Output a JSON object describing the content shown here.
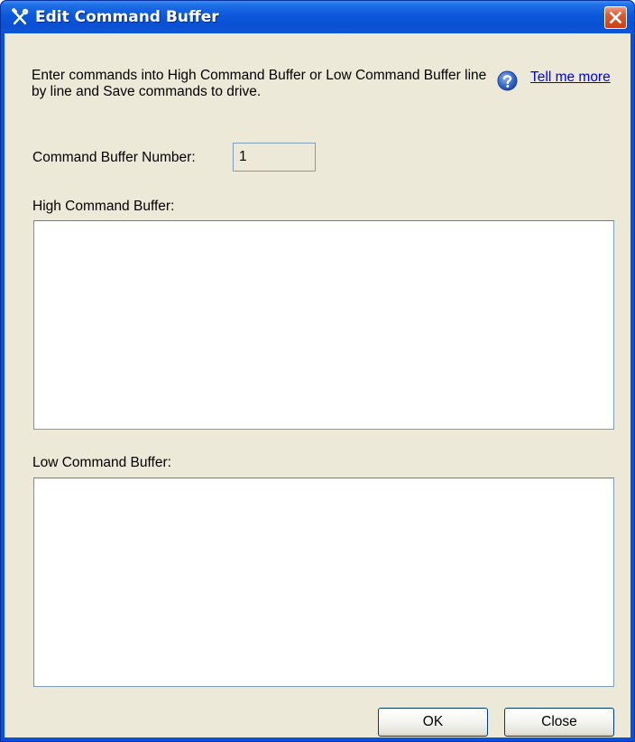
{
  "window": {
    "title": "Edit Command Buffer",
    "title_icon": "tools-icon",
    "close_icon": "close-icon"
  },
  "description": "Enter commands into High Command Buffer or Low Command Buffer line by line and Save commands to drive.",
  "help": {
    "icon": "help-icon",
    "link_text": "Tell me more"
  },
  "command_buffer_number": {
    "label": "Command Buffer Number:",
    "value": "1"
  },
  "high_buffer": {
    "label": "High Command Buffer:",
    "value": ""
  },
  "low_buffer": {
    "label": "Low Command Buffer:",
    "value": ""
  },
  "buttons": {
    "ok_label": "OK",
    "close_label": "Close"
  },
  "colors": {
    "titlebar": "#0a50d8",
    "client_background": "#ece9d8",
    "link": "#0000ee",
    "close_button": "#e15a32"
  }
}
